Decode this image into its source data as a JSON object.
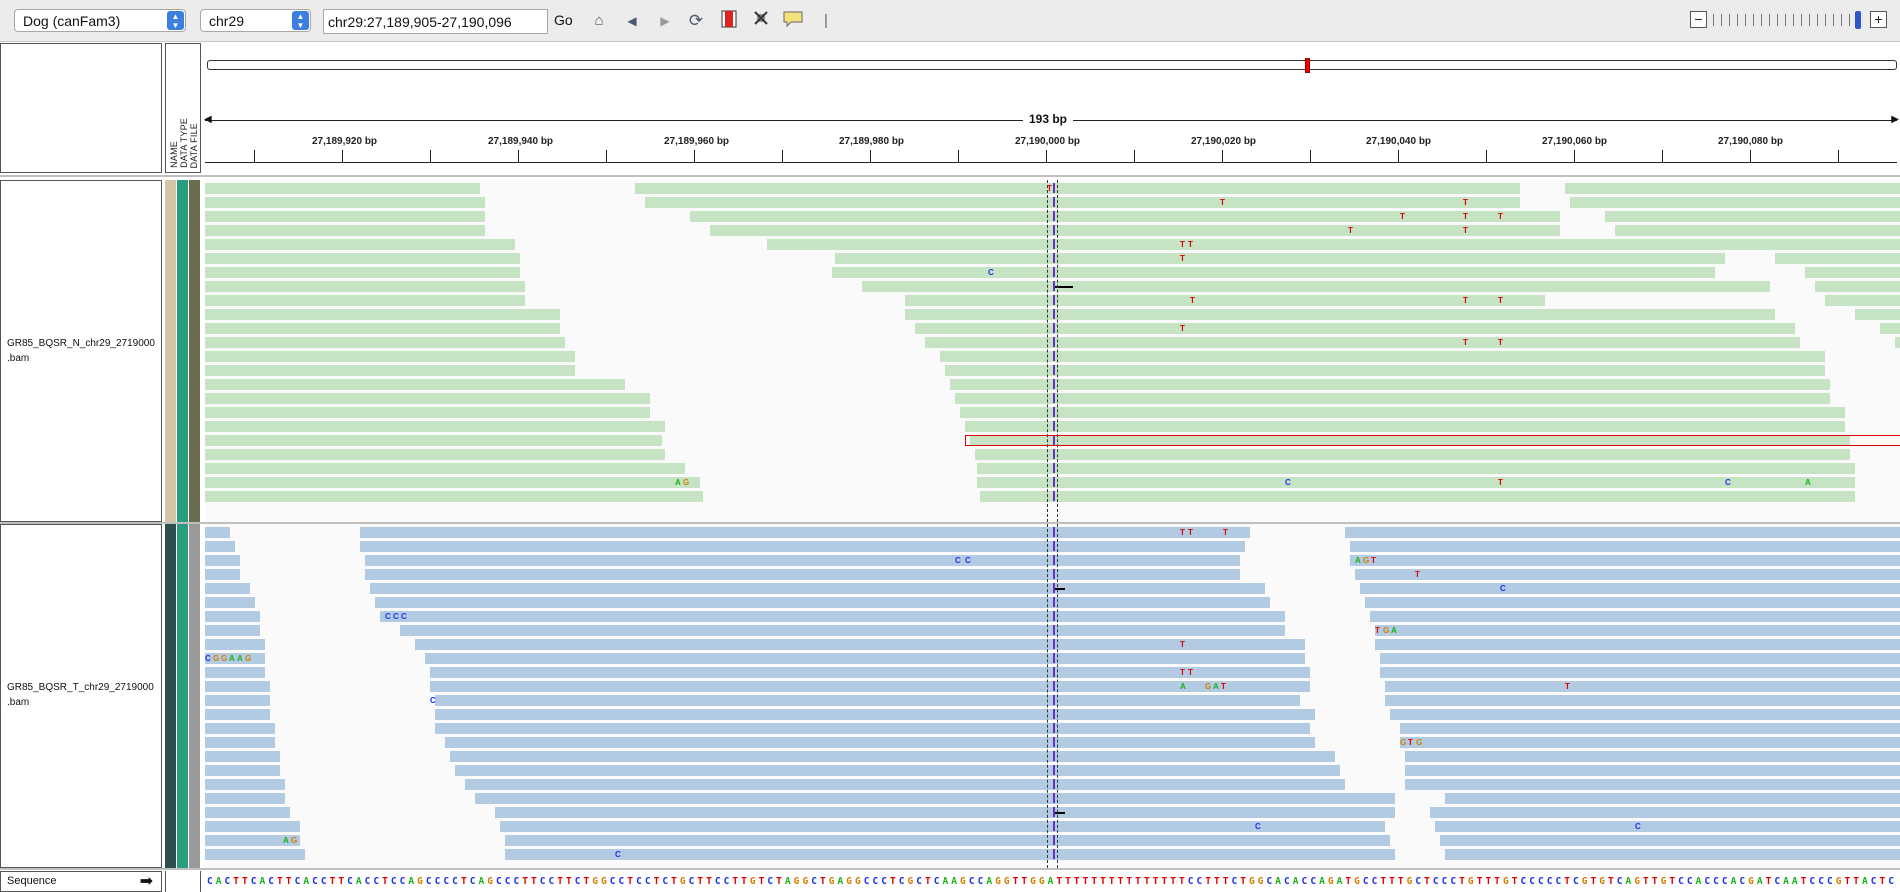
{
  "toolbar": {
    "genome": "Dog (canFam3)",
    "chromosome": "chr29",
    "locus": "chr29:27,189,905-27,190,096",
    "go_label": "Go",
    "icons": [
      "home-icon",
      "back-icon",
      "forward-icon",
      "refresh-icon",
      "region-icon",
      "resize-icon",
      "popup-info-icon"
    ]
  },
  "header": {
    "attribute_labels": [
      "NAME",
      "DATA TYPE",
      "DATA FILE"
    ],
    "span_label": "193 bp",
    "ticks": [
      "27,189,920 bp",
      "27,189,940 bp",
      "27,189,960 bp",
      "27,189,980 bp",
      "27,190,000 bp",
      "27,190,020 bp",
      "27,190,040 bp",
      "27,190,060 bp",
      "27,190,080 bp"
    ]
  },
  "tracks": [
    {
      "name_line1": "GR85_BQSR_N_chr29_2719000",
      "name_line2": ".bam",
      "attr_colors": [
        "#d4c4a8",
        "#2a9d7f",
        "#6b6b4f"
      ]
    },
    {
      "name_line1": "GR85_BQSR_T_chr29_2719000",
      "name_line2": ".bam",
      "attr_colors": [
        "#2f4f4f",
        "#2a9d7f",
        "#9a9a9a"
      ]
    }
  ],
  "sequence": {
    "label": "Sequence",
    "bases": "CACTTCACTTCACCTTCACCTCCAGCCCCTCAGCCCTTCCTTCTGGCCTCCTCTGCTTCCTTGTCTAGGCTGAGGCCCTCGCTCAAGCCAGGTTGGATTTTTTTTTTTTTTTCCTTTCTGGCACACCAGATGCCTTTGCTCCCTGTTTGTCCCCCTCGTGTCAGTTGTCCACCCACGATCAATCCCGTTACTC"
  },
  "colors": {
    "normal_read": "#c6e3c4",
    "tumor_read": "#b3cbe2",
    "base_A": "#18b018",
    "base_C": "#1a2ff0",
    "base_G": "#d08000",
    "base_T": "#e00000"
  }
}
